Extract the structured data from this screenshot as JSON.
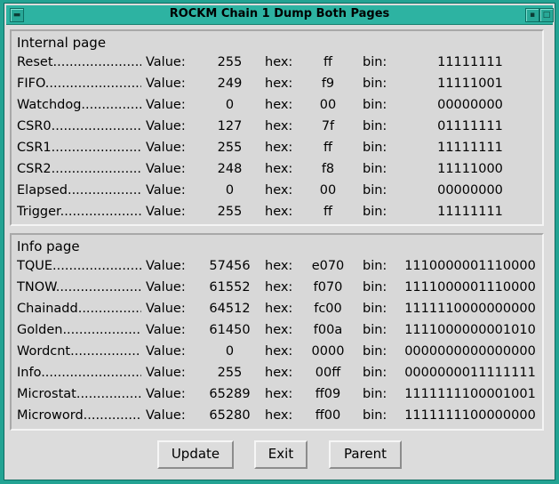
{
  "window": {
    "title": "ROCKM Chain 1 Dump Both Pages"
  },
  "labels": {
    "value": "Value:",
    "hex": "hex:",
    "bin": "bin:"
  },
  "internal": {
    "title": "Internal page",
    "rows": [
      {
        "name": "Reset......................",
        "value": "255",
        "hex": "ff",
        "bin": "11111111"
      },
      {
        "name": "FIFO........................",
        "value": "249",
        "hex": "f9",
        "bin": "11111001"
      },
      {
        "name": "Watchdog...............",
        "value": "0",
        "hex": "00",
        "bin": "00000000"
      },
      {
        "name": "CSR0........................",
        "value": "127",
        "hex": "7f",
        "bin": "01111111"
      },
      {
        "name": "CSR1........................",
        "value": "255",
        "hex": "ff",
        "bin": "11111111"
      },
      {
        "name": "CSR2........................",
        "value": "248",
        "hex": "f8",
        "bin": "11111000"
      },
      {
        "name": "Elapsed..................",
        "value": "0",
        "hex": "00",
        "bin": "00000000"
      },
      {
        "name": "Trigger.....................",
        "value": "255",
        "hex": "ff",
        "bin": "11111111"
      }
    ]
  },
  "info": {
    "title": "Info page",
    "rows": [
      {
        "name": "TQUE........................",
        "value": "57456",
        "hex": "e070",
        "bin": "1110000001110000"
      },
      {
        "name": "TNOW.......................",
        "value": "61552",
        "hex": "f070",
        "bin": "1111000001110000"
      },
      {
        "name": "Chainadd................",
        "value": "64512",
        "hex": "fc00",
        "bin": "1111110000000000"
      },
      {
        "name": "Golden.....................",
        "value": "61450",
        "hex": "f00a",
        "bin": "1111000000001010"
      },
      {
        "name": "Wordcnt..................",
        "value": "0",
        "hex": "0000",
        "bin": "0000000000000000"
      },
      {
        "name": "Info...........................",
        "value": "255",
        "hex": "00ff",
        "bin": "0000000011111111"
      },
      {
        "name": "Microstat................",
        "value": "65289",
        "hex": "ff09",
        "bin": "1111111100001001"
      },
      {
        "name": "Microword..............",
        "value": "65280",
        "hex": "ff00",
        "bin": "1111111100000000"
      }
    ]
  },
  "buttons": {
    "update": "Update",
    "exit": "Exit",
    "parent": "Parent"
  }
}
